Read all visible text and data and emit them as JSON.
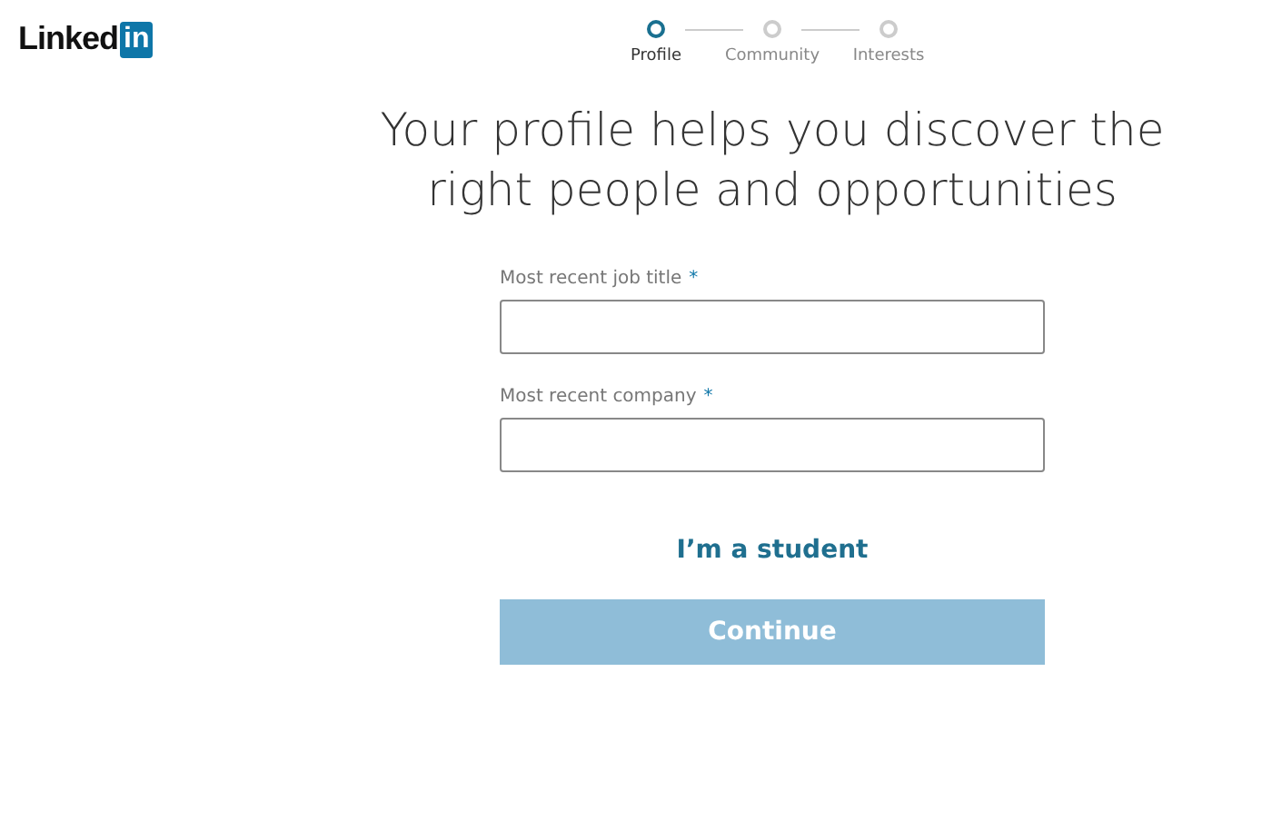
{
  "logo": {
    "word": "Linked",
    "badge": "in"
  },
  "steps": [
    {
      "label": "Profile",
      "selected": true
    },
    {
      "label": "Community",
      "selected": false
    },
    {
      "label": "Interests",
      "selected": false
    }
  ],
  "heading": "Your profile helps you discover the right people and opportunities",
  "fields": [
    {
      "label": "Most recent job title",
      "required": true,
      "required_mark": "*"
    },
    {
      "label": "Most recent company",
      "required": true,
      "required_mark": "*"
    }
  ],
  "student_link": "I’m a student",
  "continue_button": {
    "label": "Continue",
    "disabled": true
  }
}
